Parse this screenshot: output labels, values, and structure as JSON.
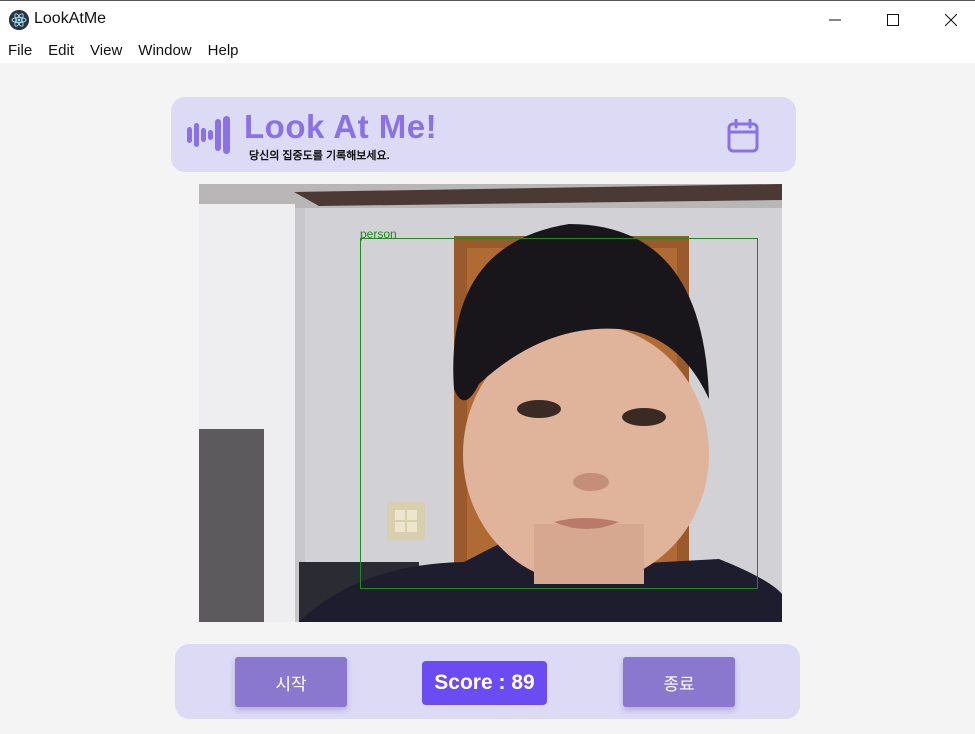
{
  "window": {
    "title": "LookAtMe"
  },
  "menu": [
    "File",
    "Edit",
    "View",
    "Window",
    "Help"
  ],
  "header": {
    "title": "Look At Me!",
    "subtitle": "당신의 집중도를 기록해보세요."
  },
  "detection": {
    "label": "person",
    "box_color": "#1f8a1f"
  },
  "controls": {
    "start_label": "시작",
    "stop_label": "종료",
    "score_label": "Score",
    "score_value": "89"
  },
  "colors": {
    "accent": "#8a72e6",
    "card_bg": "#dcdaf5",
    "button_bg": "#8a78cf",
    "score_bg": "#6b4cf3"
  },
  "icons": {
    "app": "electron-logo-icon",
    "logo": "sound-wave-icon",
    "calendar": "calendar-icon"
  }
}
